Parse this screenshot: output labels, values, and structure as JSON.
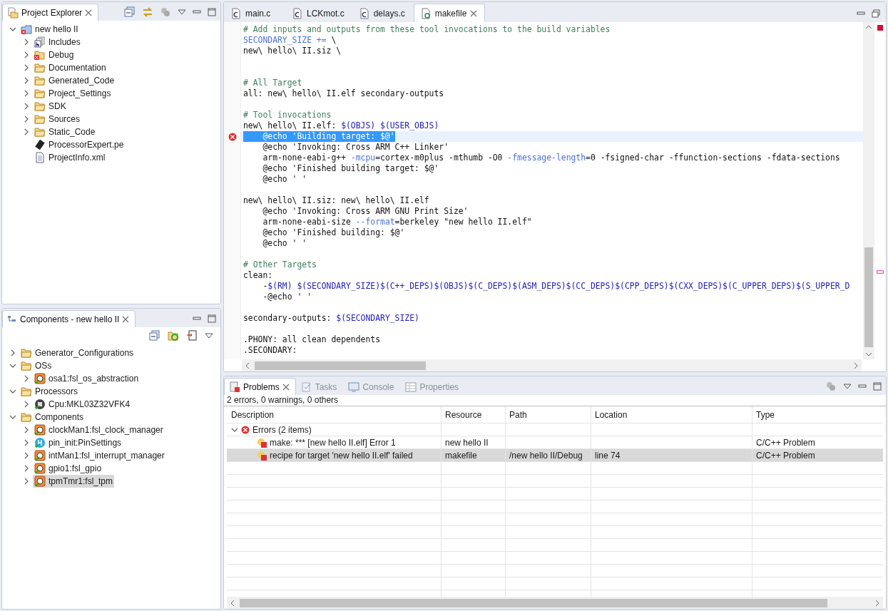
{
  "project_explorer": {
    "title": "Project Explorer",
    "tree": [
      {
        "label": "new hello II",
        "kind": "project",
        "expanded": true,
        "selected": false,
        "children": [
          {
            "label": "Includes",
            "kind": "includes",
            "expanded": false,
            "selected": false
          },
          {
            "label": "Debug",
            "kind": "folder_error",
            "expanded": false,
            "selected": false
          },
          {
            "label": "Documentation",
            "kind": "folder",
            "expanded": false,
            "selected": false
          },
          {
            "label": "Generated_Code",
            "kind": "folder",
            "expanded": false,
            "selected": false
          },
          {
            "label": "Project_Settings",
            "kind": "folder",
            "expanded": false,
            "selected": false
          },
          {
            "label": "SDK",
            "kind": "folder",
            "expanded": false,
            "selected": false
          },
          {
            "label": "Sources",
            "kind": "folder",
            "expanded": false,
            "selected": false
          },
          {
            "label": "Static_Code",
            "kind": "folder",
            "expanded": false,
            "selected": false
          },
          {
            "label": "ProcessorExpert.pe",
            "kind": "chip",
            "selected": false
          },
          {
            "label": "ProjectInfo.xml",
            "kind": "file",
            "selected": false
          }
        ]
      }
    ]
  },
  "components": {
    "title": "Components - new hello II",
    "tree": [
      {
        "label": "Generator_Configurations",
        "kind": "folder",
        "expanded": false,
        "selected": false
      },
      {
        "label": "OSs",
        "kind": "folder",
        "expanded": true,
        "selected": false,
        "children": [
          {
            "label": "osa1:fsl_os_abstraction",
            "kind": "component",
            "expanded": false,
            "selected": false
          }
        ]
      },
      {
        "label": "Processors",
        "kind": "folder",
        "expanded": true,
        "selected": false,
        "children": [
          {
            "label": "Cpu:MKL03Z32VFK4",
            "kind": "cpu",
            "expanded": false,
            "selected": false
          }
        ]
      },
      {
        "label": "Components",
        "kind": "folder",
        "expanded": true,
        "selected": false,
        "children": [
          {
            "label": "clockMan1:fsl_clock_manager",
            "kind": "component",
            "expanded": false,
            "selected": false
          },
          {
            "label": "pin_init:PinSettings",
            "kind": "pin",
            "expanded": false,
            "selected": false
          },
          {
            "label": "intMan1:fsl_interrupt_manager",
            "kind": "component",
            "expanded": false,
            "selected": false
          },
          {
            "label": "gpio1:fsl_gpio",
            "kind": "component",
            "expanded": false,
            "selected": false
          },
          {
            "label": "tpmTmr1:fsl_tpm",
            "kind": "component",
            "expanded": false,
            "selected": true
          }
        ]
      }
    ]
  },
  "editor": {
    "tabs": [
      {
        "label": "main.c",
        "selected": false
      },
      {
        "label": "LCKmot.c",
        "selected": false
      },
      {
        "label": "delays.c",
        "selected": false
      },
      {
        "label": "makefile",
        "selected": true
      }
    ],
    "lines": [
      {
        "kind": "code",
        "segments": [
          {
            "kind": "comment",
            "text": "# Add inputs and outputs from these tool invocations to the build variables"
          }
        ]
      },
      {
        "kind": "code",
        "segments": [
          {
            "kind": "keyword",
            "text": "SECONDARY_SIZE +="
          },
          {
            "kind": "text",
            "text": " \\"
          }
        ]
      },
      {
        "kind": "code",
        "segments": [
          {
            "kind": "text",
            "text": "new\\ hello\\ II.siz \\"
          }
        ]
      },
      {
        "kind": "blank"
      },
      {
        "kind": "blank"
      },
      {
        "kind": "code",
        "segments": [
          {
            "kind": "comment",
            "text": "# All Target"
          }
        ]
      },
      {
        "kind": "code",
        "segments": [
          {
            "kind": "text",
            "text": "all: new\\ hello\\ II.elf secondary-outputs"
          }
        ]
      },
      {
        "kind": "blank"
      },
      {
        "kind": "code",
        "segments": [
          {
            "kind": "comment",
            "text": "# Tool invocations"
          }
        ]
      },
      {
        "kind": "code",
        "segments": [
          {
            "kind": "text",
            "text": "new\\ hello\\ II.elf: "
          },
          {
            "kind": "var",
            "text": "$(OBJS) $(USER_OBJS)"
          }
        ]
      },
      {
        "kind": "code",
        "selected": true,
        "error": true,
        "segments": [
          {
            "kind": "text",
            "text": "    @echo 'Building target: $@'"
          }
        ]
      },
      {
        "kind": "code",
        "segments": [
          {
            "kind": "text",
            "text": "    @echo 'Invoking: Cross ARM C++ Linker'"
          }
        ]
      },
      {
        "kind": "code",
        "segments": [
          {
            "kind": "text",
            "text": "    arm-none-eabi-g++ "
          },
          {
            "kind": "keyword",
            "text": "-mcpu"
          },
          {
            "kind": "text",
            "text": "=cortex-m0plus -mthumb -O0 "
          },
          {
            "kind": "keyword",
            "text": "-fmessage-length"
          },
          {
            "kind": "text",
            "text": "=0 -fsigned-char -ffunction-sections -fdata-sections"
          }
        ]
      },
      {
        "kind": "code",
        "segments": [
          {
            "kind": "text",
            "text": "    @echo 'Finished building target: $@'"
          }
        ]
      },
      {
        "kind": "code",
        "segments": [
          {
            "kind": "text",
            "text": "    @echo ' '"
          }
        ]
      },
      {
        "kind": "blank"
      },
      {
        "kind": "code",
        "segments": [
          {
            "kind": "text",
            "text": "new\\ hello\\ II.siz: new\\ hello\\ II.elf"
          }
        ]
      },
      {
        "kind": "code",
        "segments": [
          {
            "kind": "text",
            "text": "    @echo 'Invoking: Cross ARM GNU Print Size'"
          }
        ]
      },
      {
        "kind": "code",
        "segments": [
          {
            "kind": "text",
            "text": "    arm-none-eabi-size "
          },
          {
            "kind": "keyword",
            "text": "--format"
          },
          {
            "kind": "text",
            "text": "=berkeley \"new hello II.elf\""
          }
        ]
      },
      {
        "kind": "code",
        "segments": [
          {
            "kind": "text",
            "text": "    @echo 'Finished building: $@'"
          }
        ]
      },
      {
        "kind": "code",
        "segments": [
          {
            "kind": "text",
            "text": "    @echo ' '"
          }
        ]
      },
      {
        "kind": "blank"
      },
      {
        "kind": "code",
        "segments": [
          {
            "kind": "comment",
            "text": "# Other Targets"
          }
        ]
      },
      {
        "kind": "code",
        "segments": [
          {
            "kind": "text",
            "text": "clean:"
          }
        ]
      },
      {
        "kind": "code",
        "segments": [
          {
            "kind": "text",
            "text": "    -"
          },
          {
            "kind": "var",
            "text": "$(RM) $(SECONDARY_SIZE)$(C++_DEPS)$(OBJS)$(C_DEPS)$(ASM_DEPS)$(CC_DEPS)$(CPP_DEPS)$(CXX_DEPS)$(C_UPPER_DEPS)$(S_UPPER_D"
          }
        ]
      },
      {
        "kind": "code",
        "segments": [
          {
            "kind": "text",
            "text": "    -@echo ' '"
          }
        ]
      },
      {
        "kind": "blank"
      },
      {
        "kind": "code",
        "segments": [
          {
            "kind": "text",
            "text": "secondary-outputs: "
          },
          {
            "kind": "var",
            "text": "$(SECONDARY_SIZE)"
          }
        ]
      },
      {
        "kind": "blank"
      },
      {
        "kind": "code",
        "segments": [
          {
            "kind": "text",
            "text": ".PHONY: all clean dependents"
          }
        ]
      },
      {
        "kind": "code",
        "segments": [
          {
            "kind": "text",
            "text": ".SECONDARY:"
          }
        ]
      }
    ]
  },
  "problems": {
    "tabs": [
      {
        "label": "Problems",
        "selected": true
      },
      {
        "label": "Tasks",
        "selected": false
      },
      {
        "label": "Console",
        "selected": false
      },
      {
        "label": "Properties",
        "selected": false
      }
    ],
    "summary": "2 errors, 0 warnings, 0 others",
    "columns": [
      "Description",
      "Resource",
      "Path",
      "Location",
      "Type"
    ],
    "groups": [
      {
        "label": "Errors (2 items)",
        "expanded": true,
        "rows": [
          {
            "description": "make: *** [new hello II.elf] Error 1",
            "resource": "new hello II",
            "type": "C/C++ Problem",
            "selected": false
          },
          {
            "description": "recipe for target 'new hello II.elf' failed",
            "resource": "makefile",
            "path": "/new hello II/Debug",
            "location": "line 74",
            "type": "C/C++ Problem",
            "selected": true
          }
        ]
      }
    ]
  }
}
